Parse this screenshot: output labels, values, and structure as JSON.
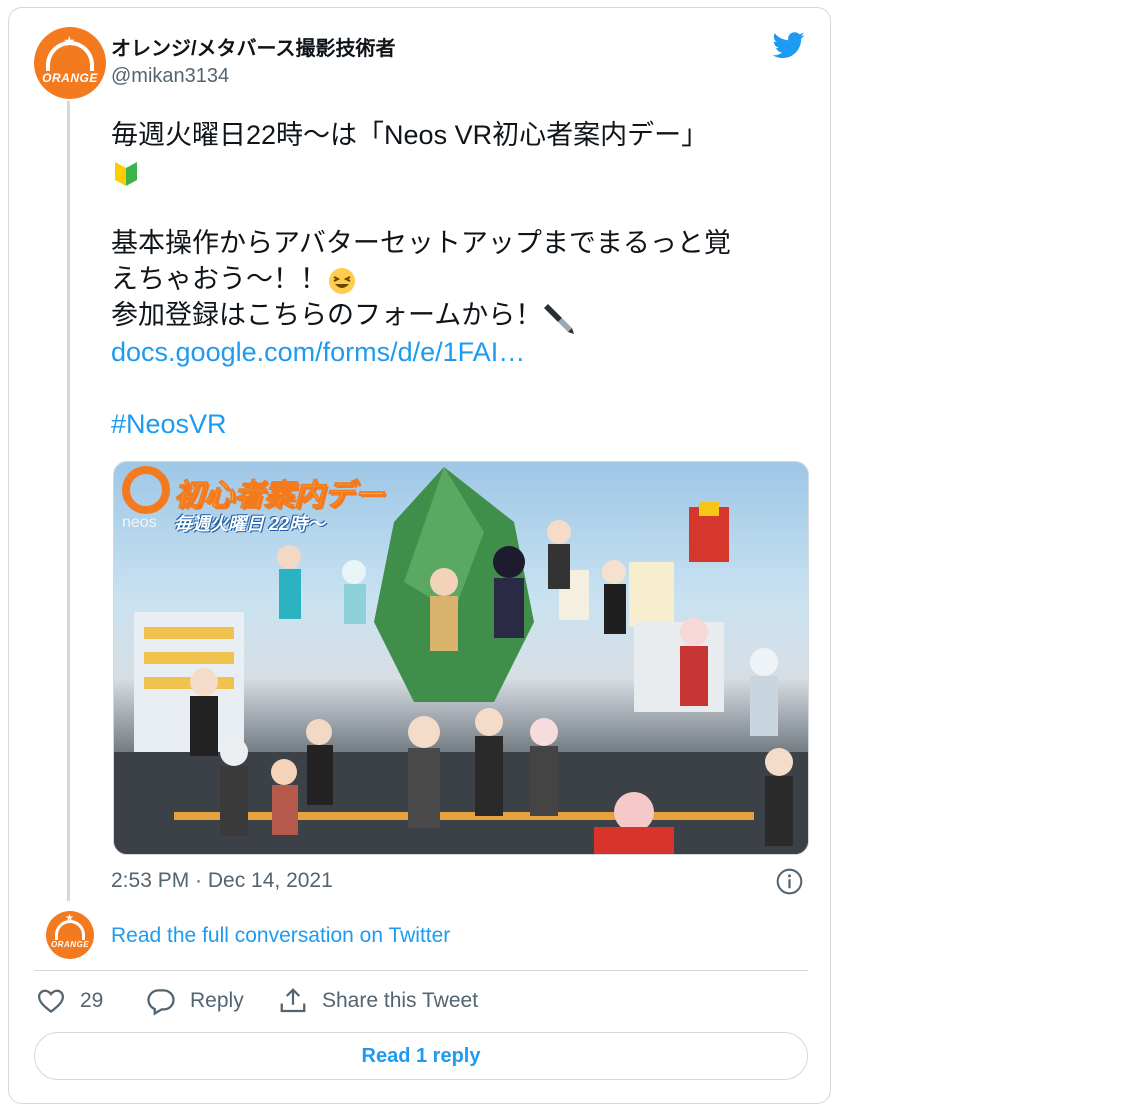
{
  "tweet": {
    "author_name": "オレンジ/メタバース撮影技術者",
    "author_handle": "@mikan3134",
    "avatar_text": "ORANGE",
    "text_lines": [
      "毎週火曜日22時〜は「Neos VR初心者案内デー」",
      "",
      "",
      "基本操作からアバターセットアップまでまるっと覚",
      "えちゃおう〜！！",
      "参加登録はこちらのフォームから！"
    ],
    "link": "docs.google.com/forms/d/e/1FAI…",
    "hashtag": "#NeosVR",
    "image_overlay": {
      "title": "初心者案内デー",
      "subtitle": "毎週火曜日 22時〜",
      "brand": "neos"
    },
    "timestamp": "2:53 PM · Dec 14, 2021"
  },
  "conversation": {
    "read_full_label": "Read the full conversation on Twitter"
  },
  "actions": {
    "like_count": "29",
    "reply_label": "Reply",
    "share_label": "Share this Tweet"
  },
  "read_reply_label": "Read 1 reply",
  "icons": {
    "brand": "twitter-bird-icon",
    "info": "info-icon",
    "like": "heart-icon",
    "reply": "reply-icon",
    "share": "share-icon",
    "beginner": "beginner-mark-emoji",
    "laugh": "laughing-face-emoji",
    "pen": "fountain-pen-emoji"
  },
  "colors": {
    "accent": "#1d9bf0",
    "secondary_text": "#536471",
    "border": "#cfd9de",
    "avatar_orange": "#f47a20"
  }
}
